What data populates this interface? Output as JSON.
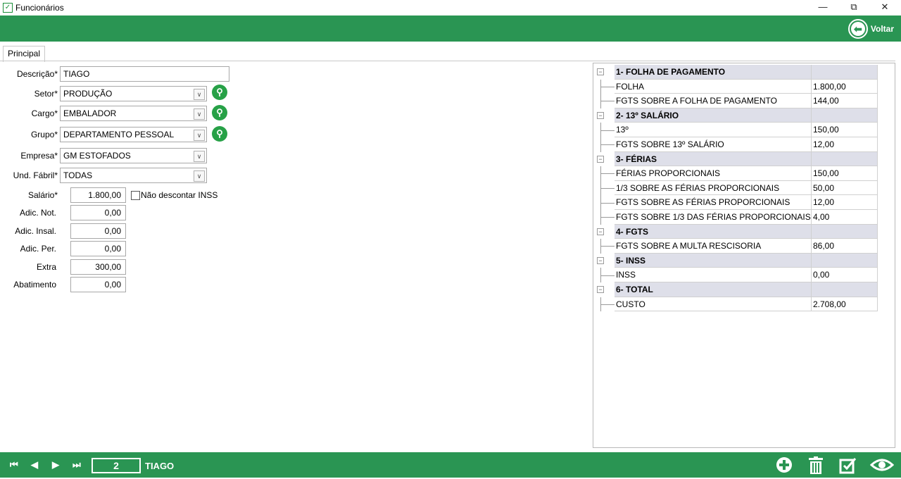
{
  "window": {
    "title": "Funcionários",
    "icon": "checkbox-app-icon",
    "minimize_glyph": "—",
    "restore_glyph": "⧉",
    "close_glyph": "✕"
  },
  "toolbar": {
    "back_label": "Voltar",
    "back_icon": "arrow-left-icon"
  },
  "tabs": [
    {
      "label": "Principal",
      "active": true
    }
  ],
  "form": {
    "descricao": {
      "label": "Descrição*",
      "value": "TIAGO"
    },
    "setor": {
      "label": "Setor*",
      "value": "PRODUÇÃO"
    },
    "cargo": {
      "label": "Cargo*",
      "value": "EMBALADOR"
    },
    "grupo": {
      "label": "Grupo*",
      "value": "DEPARTAMENTO PESSOAL"
    },
    "empresa": {
      "label": "Empresa*",
      "value": "GM ESTOFADOS"
    },
    "und_fabril": {
      "label": "Und. Fábril*",
      "value": "TODAS"
    },
    "salario": {
      "label": "Salário*",
      "value": "1.800,00"
    },
    "nao_descontar_inss": {
      "label": "Não descontar INSS",
      "checked": false
    },
    "adic_not": {
      "label": "Adic. Not.",
      "value": "0,00"
    },
    "adic_insal": {
      "label": "Adic. Insal.",
      "value": "0,00"
    },
    "adic_per": {
      "label": "Adic. Per.",
      "value": "0,00"
    },
    "extra": {
      "label": "Extra",
      "value": "300,00"
    },
    "abatimento": {
      "label": "Abatimento",
      "value": "0,00"
    }
  },
  "cost_grid": {
    "groups": [
      {
        "title": "1- FOLHA DE PAGAMENTO",
        "rows": [
          {
            "desc": "FOLHA",
            "value": "1.800,00"
          },
          {
            "desc": "FGTS SOBRE A FOLHA DE PAGAMENTO",
            "value": "144,00"
          }
        ]
      },
      {
        "title": "2- 13º SALÁRIO",
        "rows": [
          {
            "desc": "13º",
            "value": "150,00"
          },
          {
            "desc": "FGTS SOBRE 13º SALÁRIO",
            "value": "12,00"
          }
        ]
      },
      {
        "title": "3- FÉRIAS",
        "rows": [
          {
            "desc": "FÉRIAS PROPORCIONAIS",
            "value": "150,00"
          },
          {
            "desc": "1/3 SOBRE AS FÉRIAS PROPORCIONAIS",
            "value": "50,00"
          },
          {
            "desc": "FGTS SOBRE AS FÉRIAS PROPORCIONAIS",
            "value": "12,00"
          },
          {
            "desc": "FGTS SOBRE 1/3 DAS FÉRIAS PROPORCIONAIS",
            "value": "4,00"
          }
        ]
      },
      {
        "title": "4- FGTS",
        "rows": [
          {
            "desc": "FGTS SOBRE A MULTA RESCISORIA",
            "value": "86,00"
          }
        ]
      },
      {
        "title": "5- INSS",
        "rows": [
          {
            "desc": "INSS",
            "value": "0,00"
          }
        ]
      },
      {
        "title": "6- TOTAL",
        "rows": [
          {
            "desc": "CUSTO",
            "value": "2.708,00"
          }
        ]
      }
    ]
  },
  "navigator": {
    "first_glyph": "⏮",
    "prev_glyph": "◀",
    "next_glyph": "▶",
    "last_glyph": "⏭",
    "record_number": "2",
    "record_name": "TIAGO"
  },
  "actions": {
    "add_icon": "plus-circle-icon",
    "delete_icon": "trash-icon",
    "edit_icon": "edit-check-icon",
    "view_icon": "eye-icon"
  },
  "colors": {
    "bar_green": "#2a9553",
    "search_green": "#27a147",
    "group_row_bg": "#dedfe9"
  }
}
